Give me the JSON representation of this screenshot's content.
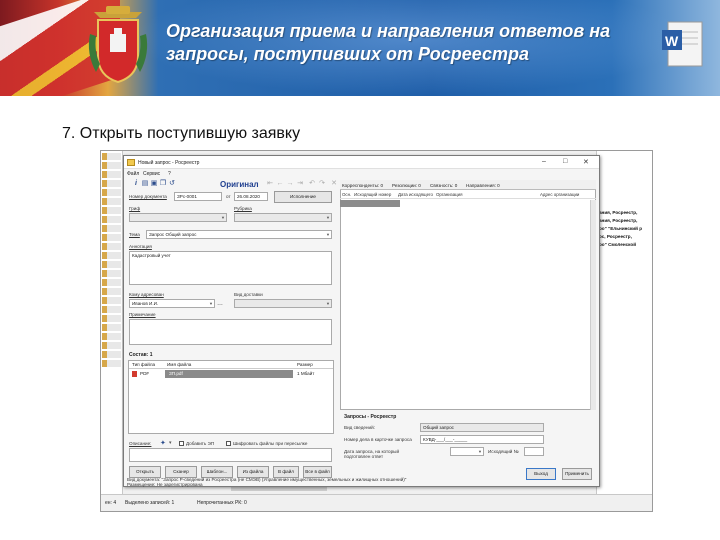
{
  "slide": {
    "title": "Организация приема и направления ответов на запросы, поступивших от Росреестра",
    "step": "7. Открыть поступившую заявку"
  },
  "app": {
    "window_title": "Новый запрос - Росреестр",
    "menu": [
      "Файл",
      "Сервис",
      "?"
    ],
    "toolbar_title": "Оригинал",
    "labels": {
      "reg_number": "Номер документа",
      "from": "от",
      "type": "Гриф",
      "rubric": "Рубрика",
      "topic": "Тема",
      "annotation": "Аннотация",
      "addressee": "Кому адресован",
      "delivery": "Вид доставки",
      "note": "Примечание",
      "composition": "Состав: 1",
      "description": "Описание:"
    },
    "values": {
      "reg_number": "ЗРс-0001",
      "date": "26.08.2020",
      "topic": "Запрос Общий запрос",
      "annotation": "Кадастровый учет",
      "addressee": "Иванов И.И."
    },
    "execution_button": "Исполнение",
    "files_columns": [
      "Тип файла",
      "Имя файла",
      "Размер"
    ],
    "files_rows": [
      {
        "type": "PDF",
        "name": "ЗП.pdf",
        "size": "1 Мбайт"
      }
    ],
    "checkboxes": {
      "add_ep": "Добавить ЭП",
      "encrypt": "Шифровать файлы при пересылке"
    },
    "file_buttons": [
      "Открыть",
      "Сканер",
      "Шаблон...",
      "Из файла",
      "В файл",
      "Все в файл"
    ],
    "tabs": [
      "Корреспонденты: 0",
      "Резолюции: 0",
      "Связность: 0",
      "Направления: 0"
    ],
    "grid_columns": [
      "Осн.",
      "Исходящий номер",
      "Дата исходящего",
      "Организация",
      "Адрес организации"
    ],
    "panel": {
      "title": "Запросы - Росреестр",
      "fields": [
        {
          "label": "Вид сведений:",
          "value": "Общий запрос"
        },
        {
          "label": "Номер дела в карточке запроса",
          "value": "КУВД-___/___-_____"
        },
        {
          "label": "Дата запроса, на который подготовлен ответ",
          "value": ""
        }
      ],
      "outgoing_label": "Исходящий №",
      "exit_button": "Выход",
      "apply_button": "Применить"
    },
    "doc_type": "Вид документа: \"Запрос Р-сведений из Росреестра (не СМЭВ) (Управление имущественных, земельных и жилищных отношений)\"",
    "registration": "Размещение: Не зарегистрирована"
  },
  "right_list": [
    "ания, Росреестр,",
    "ания, Росреестр,",
    "ро\" \"Ельнинский р",
    "ос, Росреестр,",
    "ро\" Смоленской"
  ],
  "status_bar": {
    "left": "ен: 4",
    "selected": "Выделено записей: 1",
    "unread": "Непрочитанных РК: 0"
  },
  "colors": {
    "banner_blue": "#1f5ea8",
    "title_text": "#ffffff",
    "orig_blue": "#1f3f8f"
  }
}
